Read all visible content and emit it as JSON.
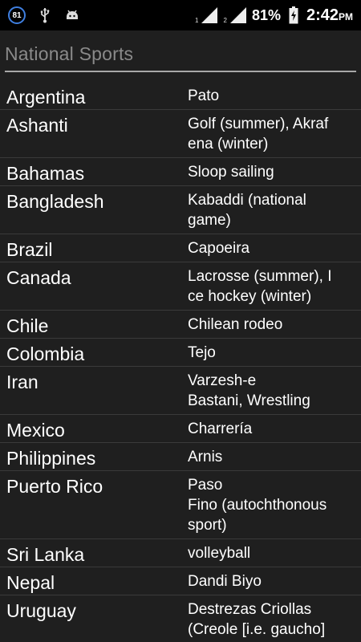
{
  "status_bar": {
    "notification_badge": "81",
    "icons": [
      "usb-icon",
      "android-icon"
    ],
    "sim1_label": "1",
    "sim2_label": "2",
    "battery_percent": "81%",
    "time": "2:42",
    "ampm": "PM"
  },
  "page": {
    "title": "National Sports"
  },
  "rows": [
    {
      "country": "Argentina",
      "sport": "Pato"
    },
    {
      "country": "Ashanti",
      "sport": "Golf (summer), Akraf\nena (winter)"
    },
    {
      "country": "Bahamas",
      "sport": "Sloop sailing"
    },
    {
      "country": "Bangladesh",
      "sport": "Kabaddi (national\ngame)"
    },
    {
      "country": "Brazil",
      "sport": "Capoeira"
    },
    {
      "country": "Canada",
      "sport": "Lacrosse (summer), I\nce hockey (winter)"
    },
    {
      "country": "Chile",
      "sport": "Chilean rodeo"
    },
    {
      "country": "Colombia",
      "sport": "Tejo"
    },
    {
      "country": "Iran",
      "sport": "Varzesh-e\nBastani, Wrestling"
    },
    {
      "country": "Mexico",
      "sport": "Charrería"
    },
    {
      "country": "Philippines",
      "sport": "Arnis"
    },
    {
      "country": "Puerto Rico",
      "sport": "Paso\nFino (autochthonous\nsport)"
    },
    {
      "country": "Sri Lanka",
      "sport": "volleyball"
    },
    {
      "country": "Nepal",
      "sport": "Dandi Biyo"
    },
    {
      "country": "Uruguay",
      "sport": "Destrezas Criollas\n(Creole [i.e. gaucho]\nSkills)"
    }
  ],
  "colors": {
    "background": "#1f1f1f",
    "status_bar": "#000000",
    "title_text": "#8a8a8a",
    "title_rule": "#a8a8a8",
    "row_divider": "#3a3a3a",
    "badge_ring": "#3f7fe0"
  }
}
